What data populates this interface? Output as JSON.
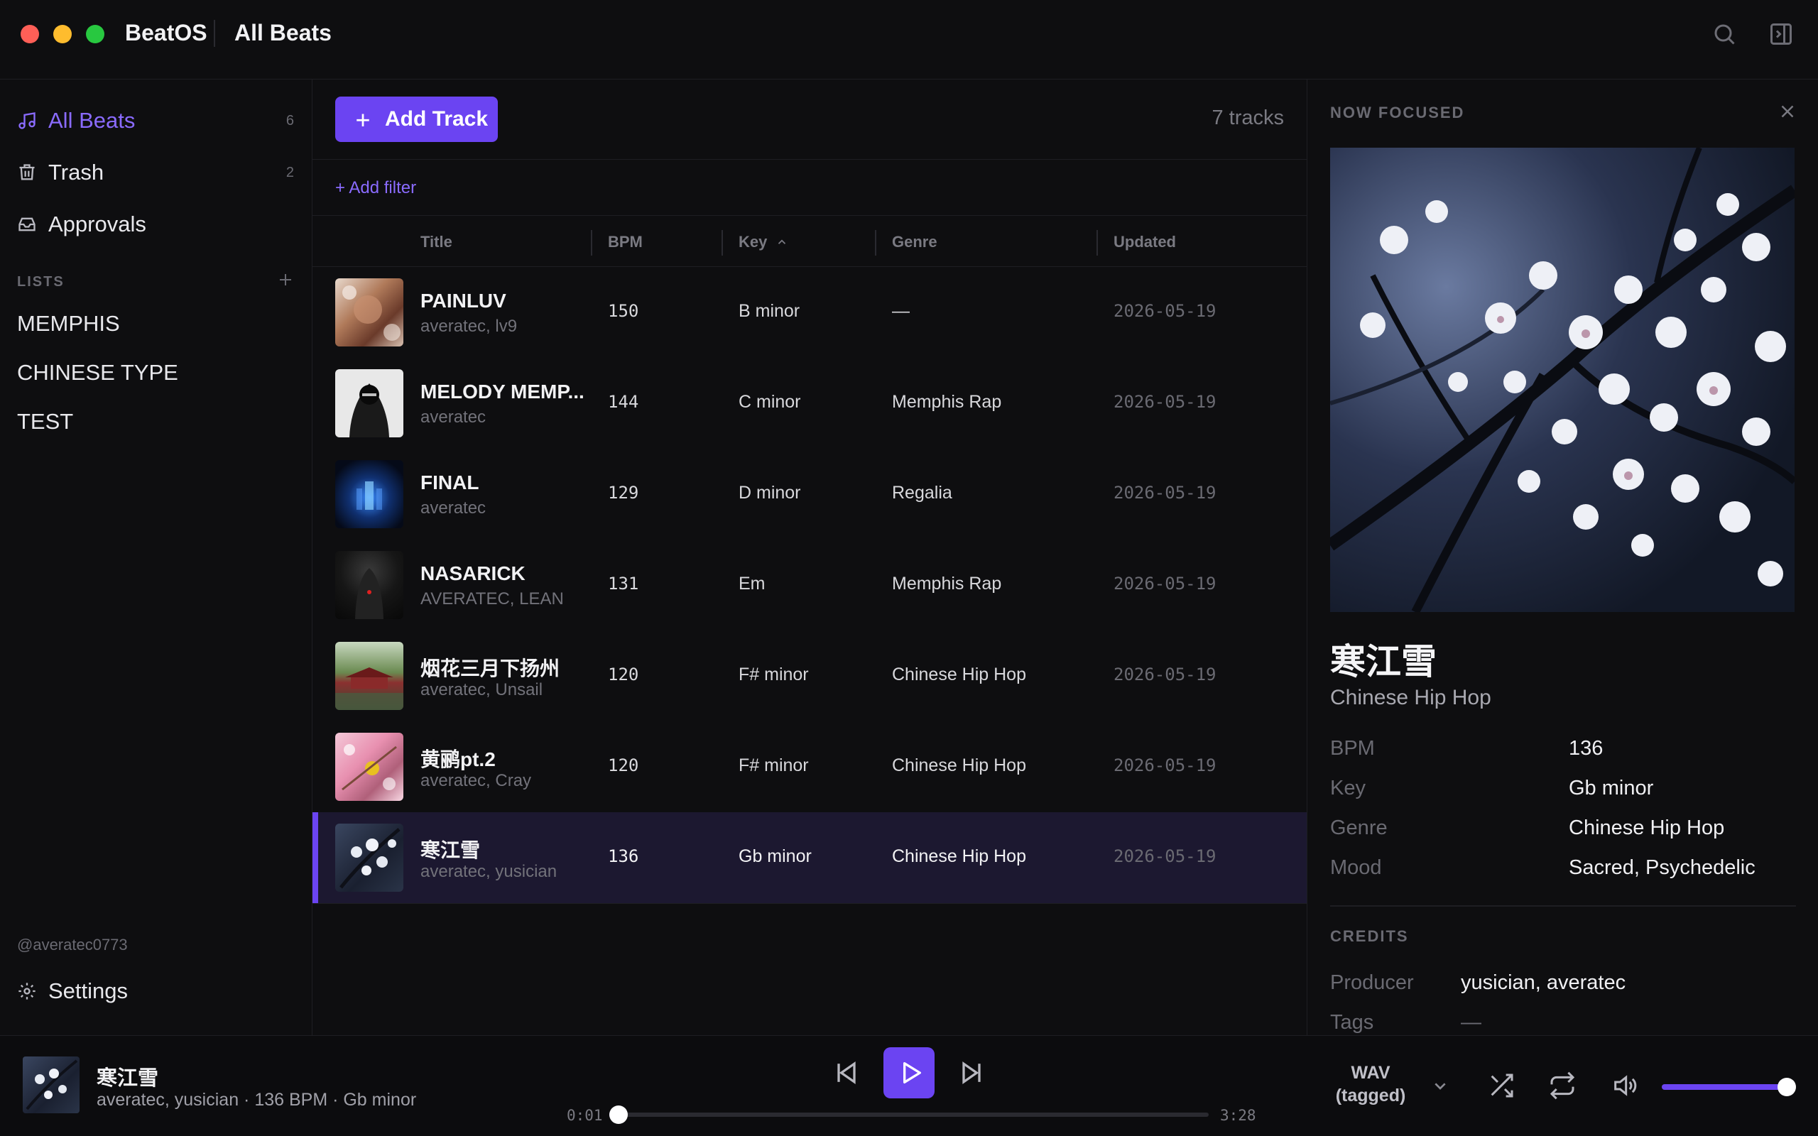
{
  "window": {
    "app_name": "BeatOS",
    "breadcrumb": "All Beats",
    "traffic_colors": [
      "#ff5f57",
      "#febc2e",
      "#28c840"
    ]
  },
  "sidebar": {
    "nav": [
      {
        "label": "All Beats",
        "count": "6",
        "icon": "music-note-icon",
        "active": true
      },
      {
        "label": "Trash",
        "count": "2",
        "icon": "trash-icon"
      },
      {
        "label": "Approvals",
        "count": "",
        "icon": "inbox-icon"
      }
    ],
    "lists_heading": "LISTS",
    "lists": [
      "MEMPHIS",
      "CHINESE TYPE",
      "TEST"
    ],
    "handle": "@averatec0773",
    "settings_label": "Settings"
  },
  "main": {
    "add_track_label": "Add Track",
    "track_count": "7 tracks",
    "add_filter_label": "+ Add filter",
    "columns": {
      "title": "Title",
      "bpm": "BPM",
      "key": "Key",
      "genre": "Genre",
      "updated": "Updated"
    },
    "sort_column": "key",
    "rows": [
      {
        "title": "PAINLUV",
        "artist": "averatec, lv9",
        "bpm": "150",
        "key": "B minor",
        "genre": "—",
        "updated": "2026-05-19"
      },
      {
        "title": "MELODY MEMP...",
        "artist": "averatec",
        "bpm": "144",
        "key": "C minor",
        "genre": "Memphis Rap",
        "updated": "2026-05-19"
      },
      {
        "title": "FINAL",
        "artist": "averatec",
        "bpm": "129",
        "key": "D minor",
        "genre": "Regalia",
        "updated": "2026-05-19"
      },
      {
        "title": "NASARICK",
        "artist": "AVERATEC, LEAN",
        "bpm": "131",
        "key": "Em",
        "genre": "Memphis Rap",
        "updated": "2026-05-19"
      },
      {
        "title": "烟花三月下扬州",
        "artist": "averatec, Unsail",
        "bpm": "120",
        "key": "F# minor",
        "genre": "Chinese Hip Hop",
        "updated": "2026-05-19"
      },
      {
        "title": "黄鹂pt.2",
        "artist": "averatec, Cray",
        "bpm": "120",
        "key": "F# minor",
        "genre": "Chinese Hip Hop",
        "updated": "2026-05-19"
      },
      {
        "title": "寒江雪",
        "artist": "averatec, yusician",
        "bpm": "136",
        "key": "Gb minor",
        "genre": "Chinese Hip Hop",
        "updated": "2026-05-19",
        "selected": true
      }
    ]
  },
  "detail": {
    "heading": "NOW FOCUSED",
    "title": "寒江雪",
    "genre": "Chinese Hip Hop",
    "fields": [
      {
        "label": "BPM",
        "value": "136"
      },
      {
        "label": "Key",
        "value": "Gb minor"
      },
      {
        "label": "Genre",
        "value": "Chinese Hip Hop"
      },
      {
        "label": "Mood",
        "value": "Sacred, Psychedelic"
      }
    ],
    "credits_heading": "CREDITS",
    "credits": [
      {
        "label": "Producer",
        "value": "yusician, averatec"
      },
      {
        "label": "Tags",
        "value": "—"
      }
    ]
  },
  "player": {
    "title": "寒江雪",
    "subtitle": "averatec, yusician · 136 BPM · Gb minor",
    "elapsed": "0:01",
    "duration": "3:28",
    "progress": 0.005,
    "format_line1": "WAV",
    "format_line2": "(tagged)",
    "volume": 1.0
  },
  "colors": {
    "accent": "#6b44f2",
    "accent_text": "#8a6bff",
    "selected_row": "#1c1830"
  }
}
